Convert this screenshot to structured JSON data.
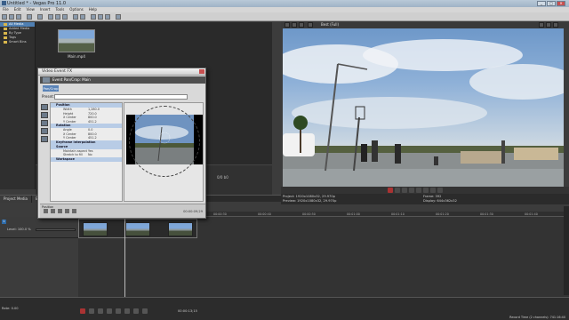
{
  "window": {
    "title": "Untitled * - Vegas Pro 11.0",
    "minimize": "_",
    "maximize": "□",
    "close": "✕"
  },
  "menu": [
    "File",
    "Edit",
    "View",
    "Insert",
    "Tools",
    "Options",
    "Help"
  ],
  "explorer": {
    "nodes": [
      "All Media",
      "Added Media",
      "By Type",
      "Tags",
      "Smart Bins"
    ],
    "selected_index": 0
  },
  "media": {
    "thumb_label": "Main.mp4",
    "stat": "0/0 b0"
  },
  "tabs": [
    "Project Media",
    "Explorer"
  ],
  "preview": {
    "quality": "Best (Full)",
    "project": "Project:   1920x1080x32, 29.970p",
    "preview": "Preview:   1920x1080x32, 29.970p",
    "frame": "Frame:   392",
    "display": "Display:   644x362x32"
  },
  "dialog": {
    "title": "Video Event FX",
    "crumb": "Event Pan/Crop:  Main",
    "fx_button": "Pan/Crop",
    "preset_label": "Preset:",
    "sections": [
      {
        "name": "Position",
        "rows": [
          [
            "Width",
            "1,280.0"
          ],
          [
            "Height",
            "720.0"
          ],
          [
            "X Center",
            "800.0"
          ],
          [
            "Y Center",
            "451.2"
          ]
        ]
      },
      {
        "name": "Rotation",
        "rows": [
          [
            "Angle",
            "0.0"
          ],
          [
            "X Center",
            "800.0"
          ],
          [
            "Y Center",
            "451.2"
          ]
        ]
      },
      {
        "name": "Keyframe interpolation",
        "rows": []
      },
      {
        "name": "Source",
        "rows": [
          [
            "Maintain aspect",
            "Yes"
          ],
          [
            "Stretch to fill",
            "No"
          ]
        ]
      },
      {
        "name": "Workspace",
        "rows": []
      }
    ],
    "timecode": "00:00:09;29",
    "position_label": "Position"
  },
  "timeline": {
    "track_number": "1",
    "level": "Level: 100.0 %",
    "ruler_ticks": [
      "00:00:00",
      "00:00:10",
      "00:00:20",
      "00:00:30",
      "00:00:40",
      "00:00:50",
      "00:01:00",
      "00:01:10",
      "00:01:20",
      "00:01:30",
      "00:01:40"
    ]
  },
  "bottom": {
    "rate": "Rate: 0.00",
    "time": "00:00:13;15",
    "record_time": "Record Time (2 channels): 741:16:40"
  }
}
